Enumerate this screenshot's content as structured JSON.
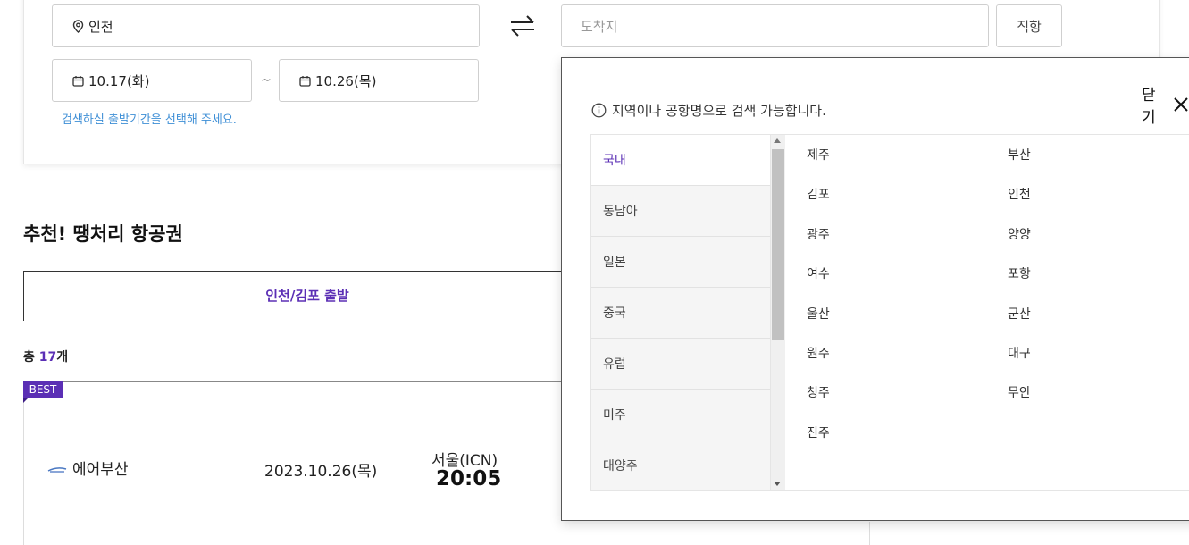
{
  "search": {
    "origin_value": "인천",
    "dest_placeholder": "도착지",
    "direct_label": "직항",
    "date_from": "10.17(화)",
    "date_to": "10.26(목)",
    "date_separator": "~",
    "hint": "검색하실 출발기간을 선택해 주세요."
  },
  "section": {
    "title": "추천! 땡처리 항공권",
    "active_tab": "인천/김포 출발",
    "count_prefix": "총 ",
    "count_number": "17",
    "count_suffix": "개"
  },
  "result": {
    "badge": "BEST",
    "airline": "에어부산",
    "date": "2023.10.26(목)",
    "departure_city": "서울(ICN)",
    "departure_time": "20:05"
  },
  "popup": {
    "close_label": "닫기",
    "info": "지역이나 공항명으로 검색 가능합니다.",
    "regions": [
      "국내",
      "동남아",
      "일본",
      "중국",
      "유럽",
      "미주",
      "대양주"
    ],
    "active_region": 0,
    "cities_col1": [
      "제주",
      "김포",
      "광주",
      "여수",
      "울산",
      "원주",
      "청주",
      "진주"
    ],
    "cities_col2": [
      "부산",
      "인천",
      "양양",
      "포항",
      "군산",
      "대구",
      "무안"
    ]
  },
  "colors": {
    "accent": "#5b2fb5",
    "hint": "#3f8fd6"
  },
  "icons": {
    "location": "location-pin-icon",
    "calendar": "calendar-icon",
    "swap": "swap-arrows-icon",
    "info": "info-circle-icon",
    "close": "close-icon"
  }
}
